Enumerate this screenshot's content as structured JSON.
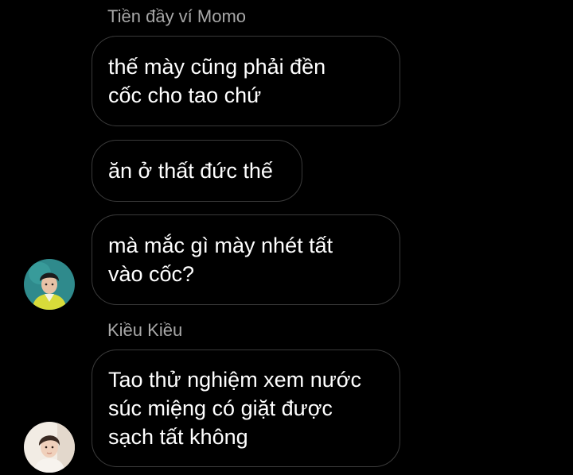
{
  "conversation": {
    "groups": [
      {
        "sender": "Tiền đầy ví Momo",
        "messages": [
          {
            "lines": [
              "thế mày cũng phải đền",
              "cốc cho tao chứ"
            ]
          },
          {
            "lines": [
              "ăn ở thất đức thế"
            ]
          },
          {
            "lines": [
              "mà mắc gì mày nhét tất",
              "vào cốc?"
            ]
          }
        ],
        "avatar": "avatar-icon"
      },
      {
        "sender": "Kiều Kiều",
        "messages": [
          {
            "lines": [
              "Tao thử nghiệm xem nước",
              "súc miệng có giặt được",
              "sạch tất không"
            ]
          }
        ],
        "avatar": "avatar-icon"
      }
    ]
  },
  "colors": {
    "background": "#000000",
    "bubble_border": "#3a3a3a",
    "sender_name": "#a8a8a8",
    "text": "#ffffff"
  }
}
